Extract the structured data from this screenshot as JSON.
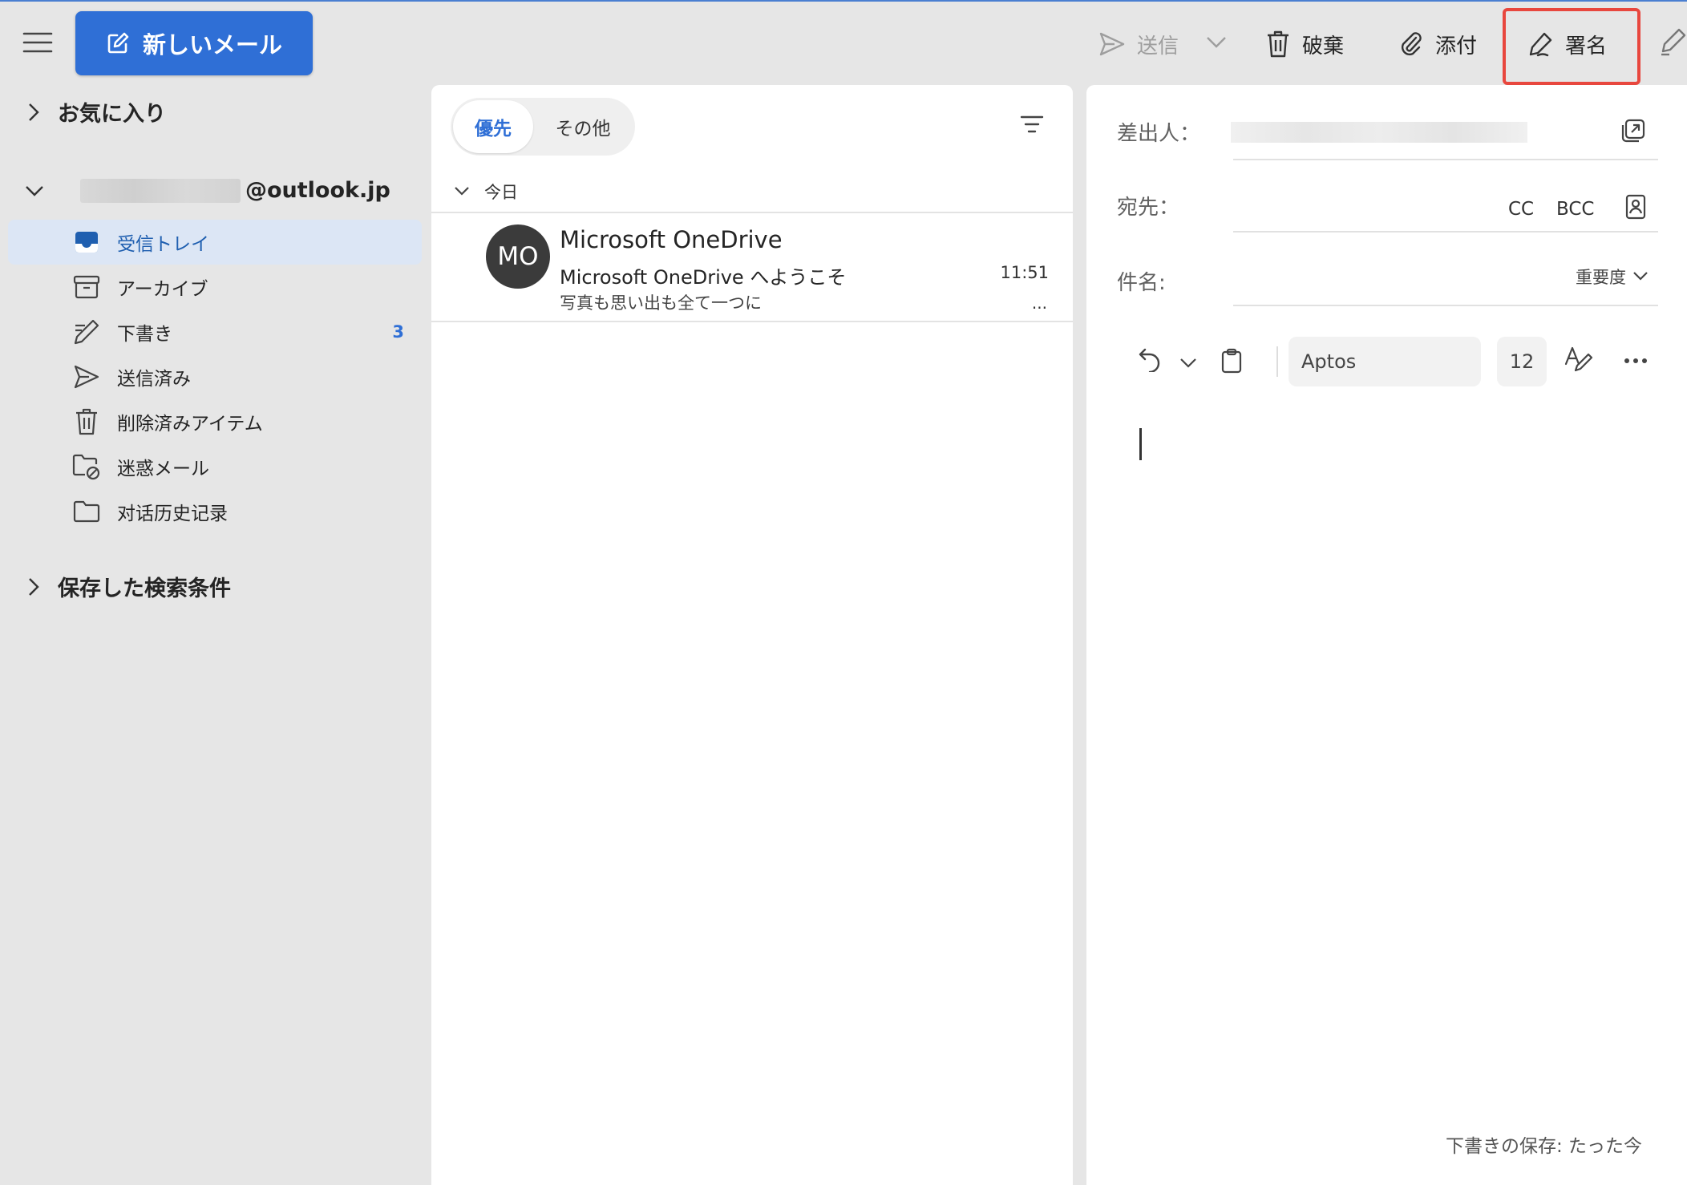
{
  "toolbar": {
    "new_mail_label": "新しいメール",
    "send_label": "送信",
    "discard_label": "破棄",
    "attach_label": "添付",
    "signature_label": "署名"
  },
  "nav": {
    "favorites_label": "お気に入り",
    "account_suffix": "@outlook.jp",
    "folders": [
      {
        "label": "受信トレイ",
        "icon": "inbox-icon",
        "selected": true,
        "count": ""
      },
      {
        "label": "アーカイブ",
        "icon": "archive-icon",
        "selected": false,
        "count": ""
      },
      {
        "label": "下書き",
        "icon": "draft-icon",
        "selected": false,
        "count": "3"
      },
      {
        "label": "送信済み",
        "icon": "sent-icon",
        "selected": false,
        "count": ""
      },
      {
        "label": "削除済みアイテム",
        "icon": "trash-icon",
        "selected": false,
        "count": ""
      },
      {
        "label": "迷惑メール",
        "icon": "junk-icon",
        "selected": false,
        "count": ""
      },
      {
        "label": "对话历史记录",
        "icon": "folder-icon",
        "selected": false,
        "count": ""
      }
    ],
    "saved_searches_label": "保存した検索条件"
  },
  "list": {
    "tab_focused": "優先",
    "tab_other": "その他",
    "group_today": "今日",
    "messages": [
      {
        "avatar": "MO",
        "from": "Microsoft OneDrive",
        "subject": "Microsoft OneDrive へようこそ",
        "preview": "写真も思い出も全て一つに",
        "time": "11:51",
        "more": "..."
      }
    ]
  },
  "compose": {
    "from_label": "差出人：",
    "to_label": "宛先：",
    "cc_label": "CC",
    "bcc_label": "BCC",
    "subject_label": "件名:",
    "importance_label": "重要度",
    "font_name": "Aptos",
    "font_size": "12",
    "draft_saved": "下書きの保存: たった今"
  },
  "colors": {
    "accent": "#2f6fd6",
    "highlight_box": "#e8473e",
    "annotation_arrow": "#ee3b36"
  }
}
